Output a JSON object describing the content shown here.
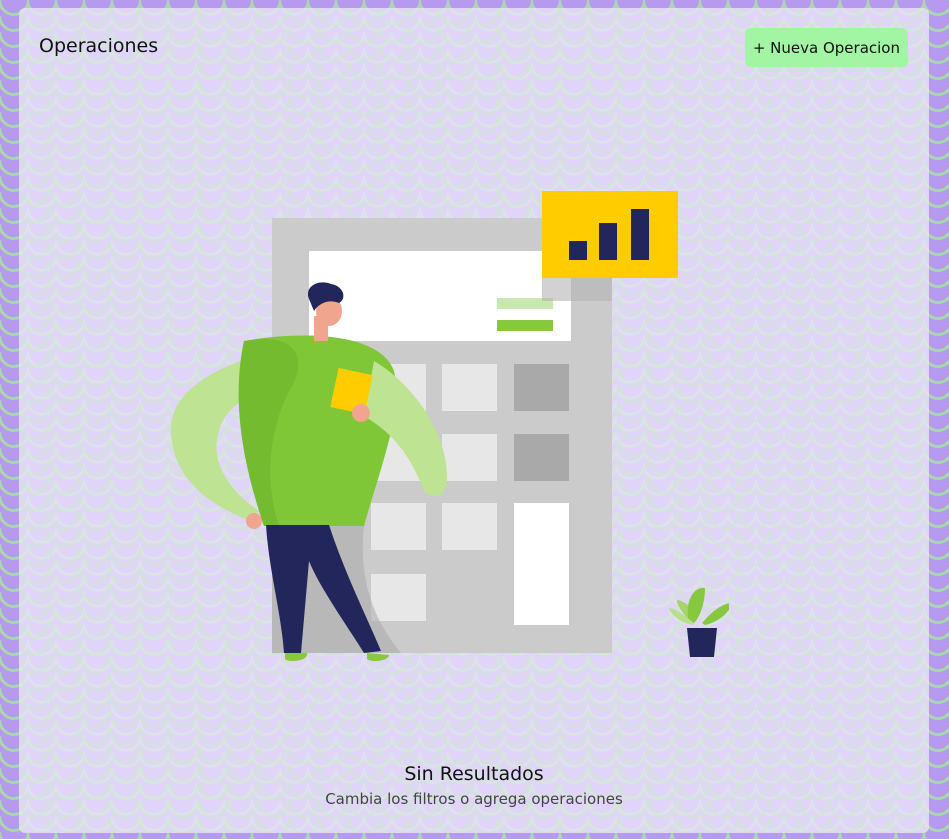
{
  "header": {
    "title": "Operaciones",
    "new_button_label": "+ Nueva Operacion"
  },
  "empty_state": {
    "title": "Sin Resultados",
    "subtitle": "Cambia los filtros o agrega operaciones",
    "illustration_icon": "calculator-person-illustration"
  },
  "colors": {
    "accent_button": "#a2f5a2",
    "background": "#b69af0",
    "illustration_green": "#7fc736",
    "illustration_yellow": "#ffcc00",
    "illustration_navy": "#22265a"
  }
}
